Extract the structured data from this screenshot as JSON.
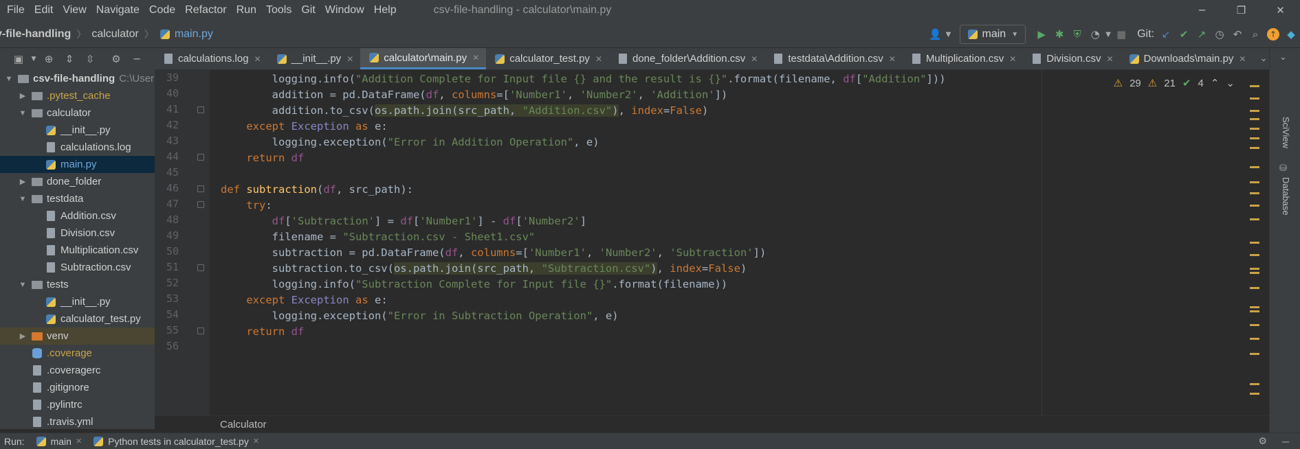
{
  "window": {
    "menu": [
      "File",
      "Edit",
      "View",
      "Navigate",
      "Code",
      "Refactor",
      "Run",
      "Tools",
      "Git",
      "Window",
      "Help"
    ],
    "title": "csv-file-handling - calculator\\main.py",
    "minimize": "─",
    "restore": "❐",
    "close": "✕"
  },
  "navbar": {
    "crumbs": [
      "v-file-handling",
      "calculator",
      "main.py"
    ],
    "branch": "main",
    "git_label": "Git:"
  },
  "tabs": [
    {
      "label": "calculations.log",
      "icon": "file"
    },
    {
      "label": "__init__.py",
      "icon": "python"
    },
    {
      "label": "calculator\\main.py",
      "icon": "python",
      "active": true
    },
    {
      "label": "calculator_test.py",
      "icon": "python"
    },
    {
      "label": "done_folder\\Addition.csv",
      "icon": "file"
    },
    {
      "label": "testdata\\Addition.csv",
      "icon": "file"
    },
    {
      "label": "Multiplication.csv",
      "icon": "file"
    },
    {
      "label": "Division.csv",
      "icon": "file"
    },
    {
      "label": "Downloads\\main.py",
      "icon": "python"
    }
  ],
  "project": {
    "root_name": "csv-file-handling",
    "root_path": "C:\\User",
    "items": [
      {
        "label": ".pytest_cache",
        "depth": 1,
        "type": "folder",
        "color": "yellow",
        "arrow": "▶"
      },
      {
        "label": "calculator",
        "depth": 1,
        "type": "folder",
        "arrow": "▼"
      },
      {
        "label": "__init__.py",
        "depth": 2,
        "type": "python"
      },
      {
        "label": "calculations.log",
        "depth": 2,
        "type": "file"
      },
      {
        "label": "main.py",
        "depth": 2,
        "type": "python",
        "selected": true,
        "color": "blue"
      },
      {
        "label": "done_folder",
        "depth": 1,
        "type": "folder",
        "arrow": "▶"
      },
      {
        "label": "testdata",
        "depth": 1,
        "type": "folder",
        "arrow": "▼"
      },
      {
        "label": "Addition.csv",
        "depth": 2,
        "type": "file"
      },
      {
        "label": "Division.csv",
        "depth": 2,
        "type": "file"
      },
      {
        "label": "Multiplication.csv",
        "depth": 2,
        "type": "file"
      },
      {
        "label": "Subtraction.csv",
        "depth": 2,
        "type": "file"
      },
      {
        "label": "tests",
        "depth": 1,
        "type": "folder",
        "arrow": "▼"
      },
      {
        "label": "__init__.py",
        "depth": 2,
        "type": "python"
      },
      {
        "label": "calculator_test.py",
        "depth": 2,
        "type": "python"
      },
      {
        "label": "venv",
        "depth": 1,
        "type": "folder-orange",
        "arrow": "▶",
        "venv": true
      },
      {
        "label": ".coverage",
        "depth": 1,
        "type": "db",
        "color": "yellow"
      },
      {
        "label": ".coveragerc",
        "depth": 1,
        "type": "file"
      },
      {
        "label": ".gitignore",
        "depth": 1,
        "type": "git"
      },
      {
        "label": ".pylintrc",
        "depth": 1,
        "type": "file"
      },
      {
        "label": ".travis.yml",
        "depth": 1,
        "type": "file"
      }
    ]
  },
  "editor": {
    "line_numbers": [
      "39",
      "40",
      "41",
      "42",
      "43",
      "44",
      "45",
      "46",
      "47",
      "48",
      "49",
      "50",
      "51",
      "52",
      "53",
      "54",
      "55",
      "56"
    ],
    "inspections": {
      "warnings": "29",
      "weak_warnings": "21",
      "typos": "4"
    },
    "breadcrumb": "Calculator"
  },
  "runbar": {
    "label": "Run:",
    "tabs": [
      "main",
      "Python tests in calculator_test.py"
    ]
  },
  "right_strip": [
    "SciView",
    "Database"
  ],
  "colors": {
    "background": "#2b2b2b",
    "panel": "#3c3f41",
    "keyword": "#cc7832",
    "string": "#6a8759",
    "param": "#94558d",
    "function": "#ffc66d",
    "accent": "#4a88c7"
  }
}
